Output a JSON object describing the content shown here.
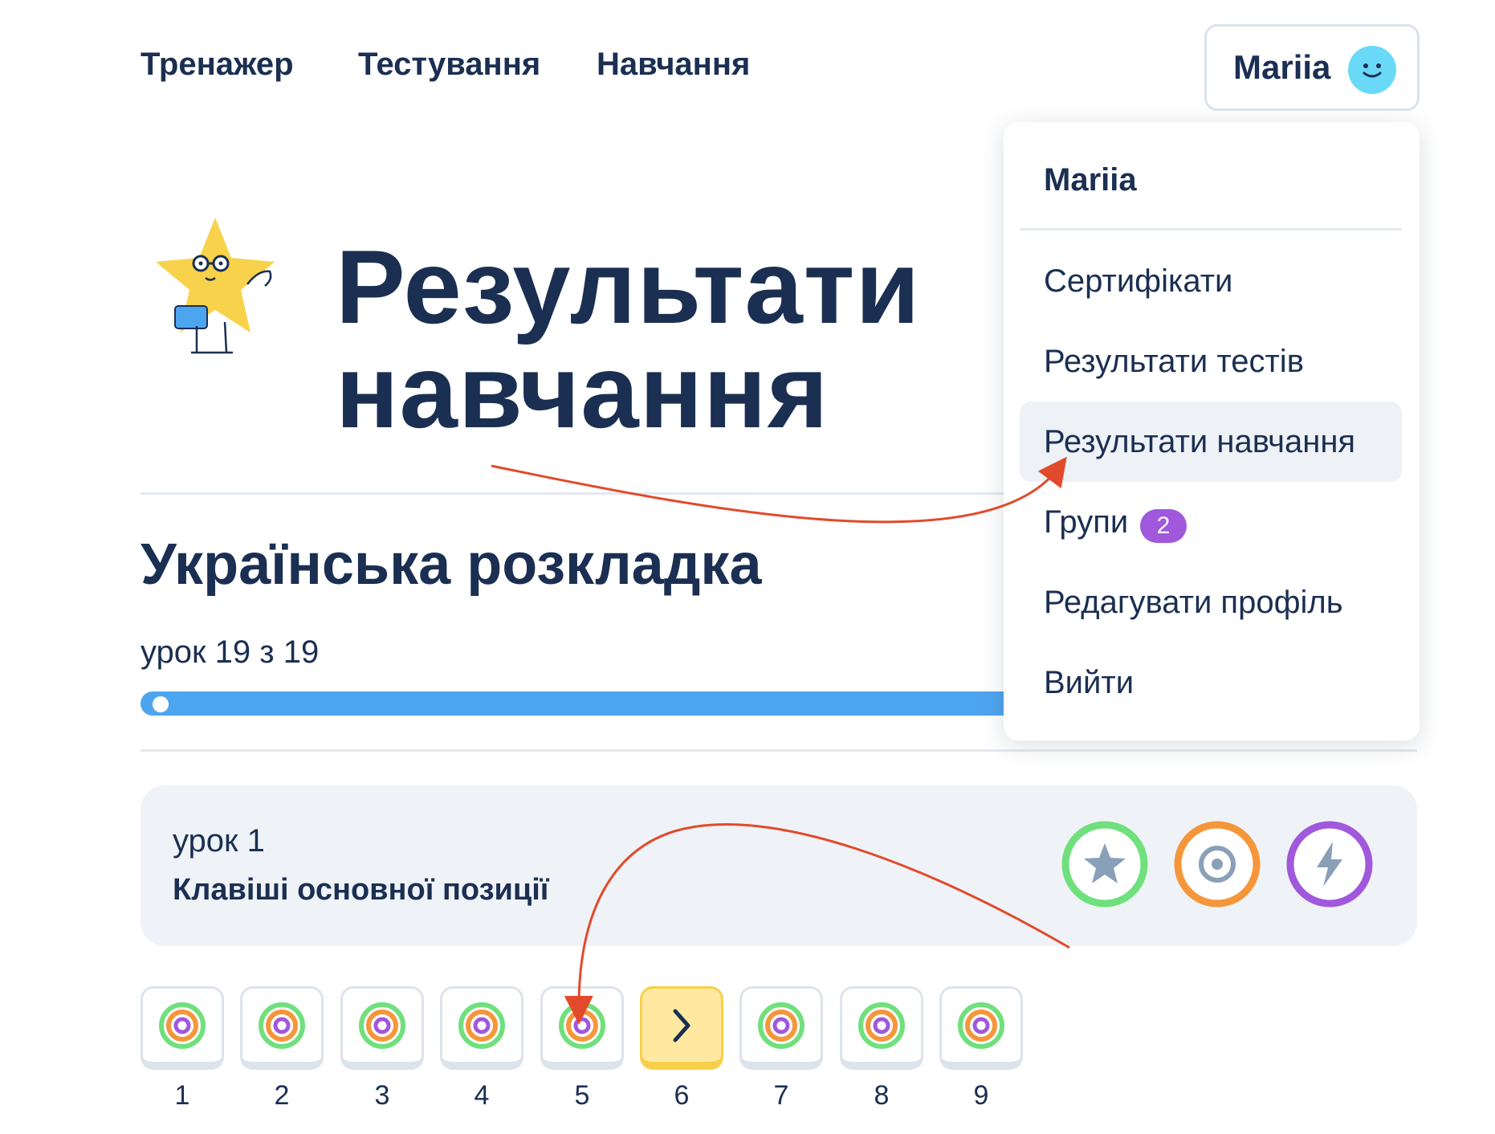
{
  "nav": {
    "items": [
      {
        "label": "Тренажер"
      },
      {
        "label": "Тестування"
      },
      {
        "label": "Навчання"
      }
    ]
  },
  "user": {
    "name": "Mariia",
    "avatar_icon": "smile-face-icon",
    "avatar_color": "#6ad9f7"
  },
  "page": {
    "title_line1": "Результати",
    "title_line2": "навчання",
    "mascot_icon": "star-mascot-icon"
  },
  "course": {
    "title": "Українська розкладка",
    "lesson_counter": "урок 19 з 19",
    "progress_fraction": 1.0,
    "progress_color": "#4ea5ef"
  },
  "lesson": {
    "number": "урок 1",
    "name": "Клавіші основної позиції",
    "badges": [
      {
        "icon": "star-icon",
        "color": "#6fe07c"
      },
      {
        "icon": "target-icon",
        "color": "#f5963a"
      },
      {
        "icon": "lightning-icon",
        "color": "#a058dc"
      }
    ]
  },
  "exercises": [
    {
      "number": "1",
      "icon": "target-icon"
    },
    {
      "number": "2",
      "icon": "target-icon"
    },
    {
      "number": "3",
      "icon": "target-icon"
    },
    {
      "number": "4",
      "icon": "target-icon"
    },
    {
      "number": "5",
      "icon": "target-icon"
    },
    {
      "number": "6",
      "icon": "chevron-right-icon",
      "current": true
    },
    {
      "number": "7",
      "icon": "target-icon"
    },
    {
      "number": "8",
      "icon": "target-icon"
    },
    {
      "number": "9",
      "icon": "target-icon"
    }
  ],
  "dropdown": {
    "user_name": "Mariia",
    "items": [
      {
        "label": "Сертифікати"
      },
      {
        "label": "Результати тестів"
      },
      {
        "label": "Результати навчання",
        "active": true
      },
      {
        "label": "Групи",
        "badge": "2"
      },
      {
        "label": "Редагувати профіль"
      },
      {
        "label": "Вийти"
      }
    ]
  },
  "colors": {
    "text": "#1b2f52",
    "annotation_arrow": "#e24a2c",
    "badge_purple": "#a058dc"
  }
}
